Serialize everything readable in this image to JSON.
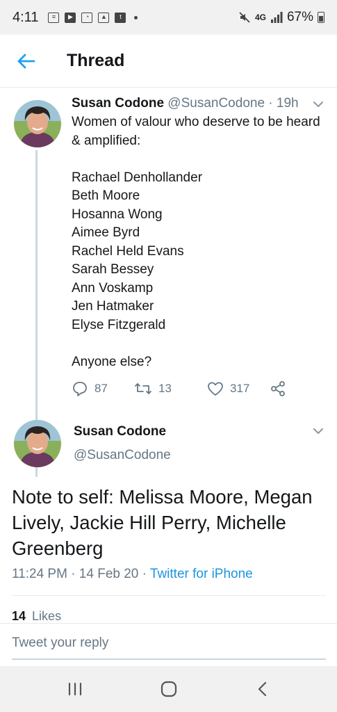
{
  "status_bar": {
    "time": "4:11",
    "network": "4G",
    "battery": "67%"
  },
  "header": {
    "title": "Thread"
  },
  "tweet1": {
    "name": "Susan Codone",
    "handle": "@SusanCodone",
    "time": "· 19h",
    "text": "Women of valour who deserve to be heard & amplified:\n\nRachael Denhollander\nBeth Moore\nHosanna Wong\nAimee Byrd\nRachel Held Evans\nSarah Bessey\nAnn Voskamp\nJen Hatmaker\nElyse Fitzgerald\n\nAnyone else?",
    "replies": "87",
    "retweets": "13",
    "likes": "317"
  },
  "tweet2": {
    "name": "Susan Codone",
    "handle": "@SusanCodone",
    "text": "Note to self: Melissa Moore, Megan Lively, Jackie Hill Perry, Michelle Greenberg",
    "time": "11:24 PM · 14 Feb 20 · ",
    "source": "Twitter for iPhone",
    "likes_count": "14",
    "likes_label": "Likes"
  },
  "reply": {
    "placeholder": "Tweet your reply"
  },
  "colors": {
    "accent": "#1da1f2",
    "muted": "#657786",
    "link": "#1b95e0"
  }
}
